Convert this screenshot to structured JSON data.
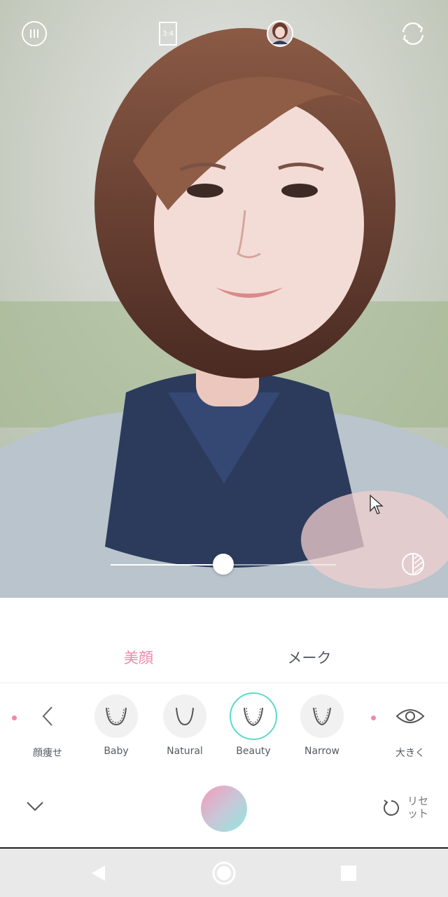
{
  "top_bar": {
    "menu_icon": "menu-dots-icon",
    "aspect_ratio_label": "3:4",
    "profile_icon": "profile-avatar-icon",
    "camera_switch_icon": "camera-switch-icon"
  },
  "preview": {
    "slider_value": 0.5,
    "compare_icon": "compare-icon"
  },
  "tabs": [
    {
      "label": "美顔",
      "active": true
    },
    {
      "label": "メーク",
      "active": false
    }
  ],
  "face_options": {
    "left_group_label": "顔痩せ",
    "right_group_label": "大きく",
    "items": [
      {
        "label": "Baby",
        "selected": false
      },
      {
        "label": "Natural",
        "selected": false
      },
      {
        "label": "Beauty",
        "selected": true
      },
      {
        "label": "Narrow",
        "selected": false
      }
    ]
  },
  "bottom_actions": {
    "collapse_icon": "chevron-down-icon",
    "shutter_icon": "shutter-button",
    "reset_label": "リセット",
    "reset_label_line1": "リセ",
    "reset_label_line2": "ット"
  },
  "navbar": {
    "back_icon": "back-icon",
    "home_icon": "home-icon",
    "recents_icon": "recents-icon"
  },
  "colors": {
    "accent_pink": "#f08aa8",
    "accent_teal": "#5fd8cc",
    "tab_inactive": "#555a60"
  }
}
